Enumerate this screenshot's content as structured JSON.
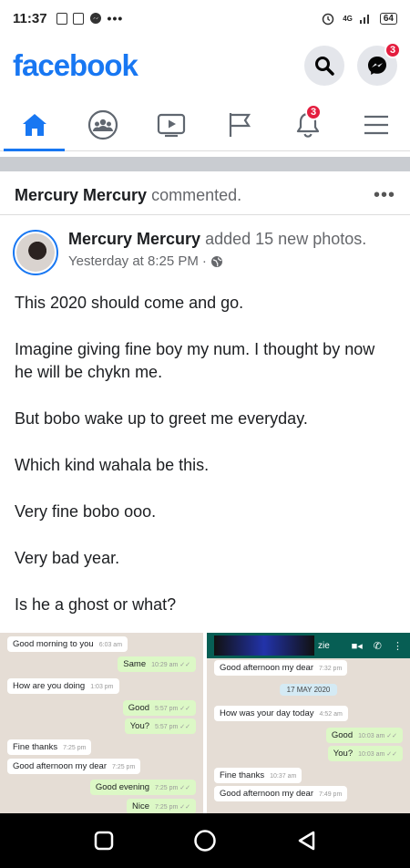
{
  "status": {
    "time": "11:37",
    "network": "4G",
    "battery": "64"
  },
  "header": {
    "logo": "facebook",
    "messenger_badge": "3"
  },
  "nav": {
    "notifications_badge": "3"
  },
  "activity": {
    "actor": "Mercury Mercury",
    "action": "commented.",
    "more": "•••"
  },
  "post": {
    "author": "Mercury Mercury",
    "action": "added 15 new photos.",
    "time": "Yesterday at 8:25 PM",
    "separator": "·",
    "paragraphs": [
      "This 2020 should come and go.",
      "Imagine giving fine boy my num.  I thought by now he will be chykn me.",
      "But bobo wake up to greet me everyday.",
      "Which kind wahala be this.",
      "Very fine bobo ooo.",
      "Very bad year.",
      "Is he a ghost or what?"
    ]
  },
  "photo1": {
    "msgs": [
      {
        "text": "Good morning to you",
        "time": "6:03 am"
      },
      {
        "text": "Same",
        "time": "10:29 am ✓✓"
      },
      {
        "text": "How are you doing",
        "time": "1:03 pm"
      },
      {
        "text": "Good",
        "time": "5:57 pm ✓✓"
      },
      {
        "text": "You?",
        "time": "5:57 pm ✓✓"
      },
      {
        "text": "Fine thanks",
        "time": "7:25 pm"
      },
      {
        "text": "Good afternoon my dear",
        "time": "7:25 pm"
      },
      {
        "text": "Good evening",
        "time": "7:25 pm ✓✓"
      },
      {
        "text": "Nice",
        "time": "7:25 pm ✓✓"
      }
    ]
  },
  "photo2": {
    "contact_suffix": "zie",
    "date_chip": "17 MAY 2020",
    "msgs": [
      {
        "text": "Good afternoon my dear",
        "time": "7:32 pm"
      },
      {
        "text": "How was your day today",
        "time": "4:52 am"
      },
      {
        "text": "Good",
        "time": "10:03 am ✓✓"
      },
      {
        "text": "You?",
        "time": "10:03 am ✓✓"
      },
      {
        "text": "Fine thanks",
        "time": "10:37 am"
      },
      {
        "text": "Good afternoon my dear",
        "time": "7:49 pm"
      }
    ]
  }
}
